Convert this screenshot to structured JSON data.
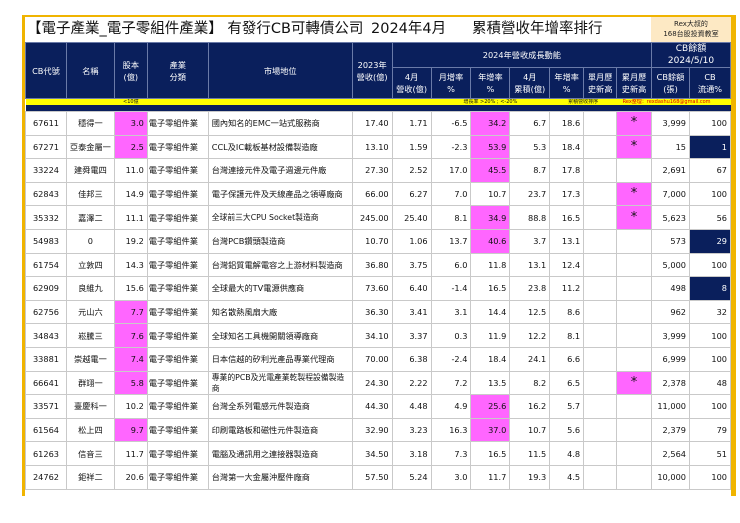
{
  "title": {
    "left": "【電子產業_電子零組件產業】 有發行CB可轉債公司",
    "period": "2024年4月",
    "right": "累積營收年增率排行"
  },
  "rex_box": {
    "line1": "Rex大叔的",
    "line2": "168台股投資教室"
  },
  "headers": {
    "code": "CB代號",
    "name": "名稱",
    "capital": "股本\n(億)",
    "industry": "產業\n分類",
    "position": "市場地位",
    "rev2023": "2023年\n營收(億)",
    "group_growth": "2024年營收成長動能",
    "group_cb": "CB餘額\n2024/5/10",
    "apr_rev": "4月\n營收(億)",
    "mom": "月增率\n%",
    "yoy": "年增率\n%",
    "apr_cum": "4月\n累積(億)",
    "cum_yoy": "年增率\n%",
    "single_high": "單月歷\n史新高",
    "cum_high": "累月歷\n史新高",
    "cb_balance": "CB餘額\n(張)",
    "cb_float": "CB\n流通%"
  },
  "band": {
    "capital_note": "<10億",
    "growth_note": "增長率 >20% ; <-20%",
    "sort_note": "累積營收排序",
    "credit": "Rex整理：rexdashu168@gmail.com"
  },
  "colors": {
    "navy": "#0a1f5c",
    "pink": "#ff66ff",
    "gold": "#f0b400",
    "yellow": "#ffff00"
  },
  "rows": [
    {
      "code": "67611",
      "name": "穩得一",
      "capital": "3.0",
      "cap_hl": true,
      "industry": "電子零組件業",
      "position": "國內知名的EMC一站式服務商",
      "rev2023": "17.40",
      "apr_rev": "1.71",
      "mom": "-6.5",
      "yoy": "34.2",
      "yoy_hl": true,
      "apr_cum": "6.7",
      "cum_yoy": "18.6",
      "single_high": "",
      "cum_high": "*",
      "cb_balance": "3,999",
      "cb_float": "100",
      "float_hl": false
    },
    {
      "code": "67271",
      "name": "亞泰金屬一",
      "capital": "2.5",
      "cap_hl": true,
      "industry": "電子零組件業",
      "position": "CCL及IC載板基材設備製造廠",
      "rev2023": "13.10",
      "apr_rev": "1.59",
      "mom": "-2.3",
      "yoy": "53.9",
      "yoy_hl": true,
      "apr_cum": "5.3",
      "cum_yoy": "18.4",
      "single_high": "",
      "cum_high": "*",
      "cb_balance": "15",
      "cb_float": "1",
      "float_hl": true
    },
    {
      "code": "33224",
      "name": "建舜電四",
      "capital": "11.0",
      "cap_hl": false,
      "industry": "電子零組件業",
      "position": "台灣連接元件及電子週邊元件廠",
      "rev2023": "27.30",
      "apr_rev": "2.52",
      "mom": "17.0",
      "yoy": "45.5",
      "yoy_hl": true,
      "apr_cum": "8.7",
      "cum_yoy": "17.8",
      "single_high": "",
      "cum_high": "",
      "cb_balance": "2,691",
      "cb_float": "67",
      "float_hl": false
    },
    {
      "code": "62843",
      "name": "佳邦三",
      "capital": "14.9",
      "cap_hl": false,
      "industry": "電子零組件業",
      "position": "電子保護元件及天線產品之領導廠商",
      "rev2023": "66.00",
      "apr_rev": "6.27",
      "mom": "7.0",
      "yoy": "10.7",
      "yoy_hl": false,
      "apr_cum": "23.7",
      "cum_yoy": "17.3",
      "single_high": "",
      "cum_high": "*",
      "cb_balance": "7,000",
      "cb_float": "100",
      "float_hl": false
    },
    {
      "code": "35332",
      "name": "嘉澤二",
      "capital": "11.1",
      "cap_hl": false,
      "industry": "電子零組件業",
      "position": "全球前三大CPU Socket製造商",
      "rev2023": "245.00",
      "apr_rev": "25.40",
      "mom": "8.1",
      "yoy": "34.9",
      "yoy_hl": true,
      "apr_cum": "88.8",
      "cum_yoy": "16.5",
      "single_high": "",
      "cum_high": "*",
      "cb_balance": "5,623",
      "cb_float": "56",
      "float_hl": false
    },
    {
      "code": "54983",
      "name": "0",
      "capital": "19.2",
      "cap_hl": false,
      "industry": "電子零組件業",
      "position": "台灣PCB鑽頭製造商",
      "rev2023": "10.70",
      "apr_rev": "1.06",
      "mom": "13.7",
      "yoy": "40.6",
      "yoy_hl": true,
      "apr_cum": "3.7",
      "cum_yoy": "13.1",
      "single_high": "",
      "cum_high": "",
      "cb_balance": "573",
      "cb_float": "29",
      "float_hl": true
    },
    {
      "code": "61754",
      "name": "立敦四",
      "capital": "14.3",
      "cap_hl": false,
      "industry": "電子零組件業",
      "position": "台灣鋁質電解電容之上游材料製造商",
      "rev2023": "36.80",
      "apr_rev": "3.75",
      "mom": "6.0",
      "yoy": "11.8",
      "yoy_hl": false,
      "apr_cum": "13.1",
      "cum_yoy": "12.4",
      "single_high": "",
      "cum_high": "",
      "cb_balance": "5,000",
      "cb_float": "100",
      "float_hl": false
    },
    {
      "code": "62909",
      "name": "良維九",
      "capital": "15.6",
      "cap_hl": false,
      "industry": "電子零組件業",
      "position": "全球最大的TV電源供應商",
      "rev2023": "73.60",
      "apr_rev": "6.40",
      "mom": "-1.4",
      "yoy": "16.5",
      "yoy_hl": false,
      "apr_cum": "23.8",
      "cum_yoy": "11.2",
      "single_high": "",
      "cum_high": "",
      "cb_balance": "498",
      "cb_float": "8",
      "float_hl": true
    },
    {
      "code": "62756",
      "name": "元山六",
      "capital": "7.7",
      "cap_hl": true,
      "industry": "電子零組件業",
      "position": "知名散熱風扇大廠",
      "rev2023": "36.30",
      "apr_rev": "3.41",
      "mom": "3.1",
      "yoy": "14.4",
      "yoy_hl": false,
      "apr_cum": "12.5",
      "cum_yoy": "8.6",
      "single_high": "",
      "cum_high": "",
      "cb_balance": "962",
      "cb_float": "32",
      "float_hl": false
    },
    {
      "code": "34843",
      "name": "崧騰三",
      "capital": "7.6",
      "cap_hl": true,
      "industry": "電子零組件業",
      "position": "全球知名工具機開關領導廠商",
      "rev2023": "34.10",
      "apr_rev": "3.37",
      "mom": "0.3",
      "yoy": "11.9",
      "yoy_hl": false,
      "apr_cum": "12.2",
      "cum_yoy": "8.1",
      "single_high": "",
      "cum_high": "",
      "cb_balance": "3,999",
      "cb_float": "100",
      "float_hl": false
    },
    {
      "code": "33881",
      "name": "崇越電一",
      "capital": "7.4",
      "cap_hl": true,
      "industry": "電子零組件業",
      "position": "日本信越的矽利光產品專業代理商",
      "rev2023": "70.00",
      "apr_rev": "6.38",
      "mom": "-2.4",
      "yoy": "18.4",
      "yoy_hl": false,
      "apr_cum": "24.1",
      "cum_yoy": "6.6",
      "single_high": "",
      "cum_high": "",
      "cb_balance": "6,999",
      "cb_float": "100",
      "float_hl": false
    },
    {
      "code": "66641",
      "name": "群翊一",
      "capital": "5.8",
      "cap_hl": true,
      "industry": "電子零組件業",
      "position": "專業的PCB及光電產業乾製程設備製造商",
      "rev2023": "24.30",
      "apr_rev": "2.22",
      "mom": "7.2",
      "yoy": "13.5",
      "yoy_hl": false,
      "apr_cum": "8.2",
      "cum_yoy": "6.5",
      "single_high": "",
      "cum_high": "*",
      "cb_balance": "2,378",
      "cb_float": "48",
      "float_hl": false
    },
    {
      "code": "33571",
      "name": "臺慶科一",
      "capital": "10.2",
      "cap_hl": false,
      "industry": "電子零組件業",
      "position": "台灣全系列電感元件製造商",
      "rev2023": "44.30",
      "apr_rev": "4.48",
      "mom": "4.9",
      "yoy": "25.6",
      "yoy_hl": true,
      "apr_cum": "16.2",
      "cum_yoy": "5.7",
      "single_high": "",
      "cum_high": "",
      "cb_balance": "11,000",
      "cb_float": "100",
      "float_hl": false
    },
    {
      "code": "61564",
      "name": "松上四",
      "capital": "9.7",
      "cap_hl": true,
      "industry": "電子零組件業",
      "position": "印刷電路板和磁性元件製造商",
      "rev2023": "32.90",
      "apr_rev": "3.23",
      "mom": "16.3",
      "yoy": "37.0",
      "yoy_hl": true,
      "apr_cum": "10.7",
      "cum_yoy": "5.6",
      "single_high": "",
      "cum_high": "",
      "cb_balance": "2,379",
      "cb_float": "79",
      "float_hl": false
    },
    {
      "code": "61263",
      "name": "信音三",
      "capital": "11.7",
      "cap_hl": false,
      "industry": "電子零組件業",
      "position": "電腦及通訊用之連接器製造商",
      "rev2023": "34.50",
      "apr_rev": "3.18",
      "mom": "7.3",
      "yoy": "16.5",
      "yoy_hl": false,
      "apr_cum": "11.5",
      "cum_yoy": "4.8",
      "single_high": "",
      "cum_high": "",
      "cb_balance": "2,564",
      "cb_float": "51",
      "float_hl": false
    },
    {
      "code": "24762",
      "name": "鉅祥二",
      "capital": "20.6",
      "cap_hl": false,
      "industry": "電子零組件業",
      "position": "台灣第一大金屬沖壓件廠商",
      "rev2023": "57.50",
      "apr_rev": "5.24",
      "mom": "3.0",
      "yoy": "11.7",
      "yoy_hl": false,
      "apr_cum": "19.3",
      "cum_yoy": "4.5",
      "single_high": "",
      "cum_high": "",
      "cb_balance": "10,000",
      "cb_float": "100",
      "float_hl": false
    }
  ]
}
